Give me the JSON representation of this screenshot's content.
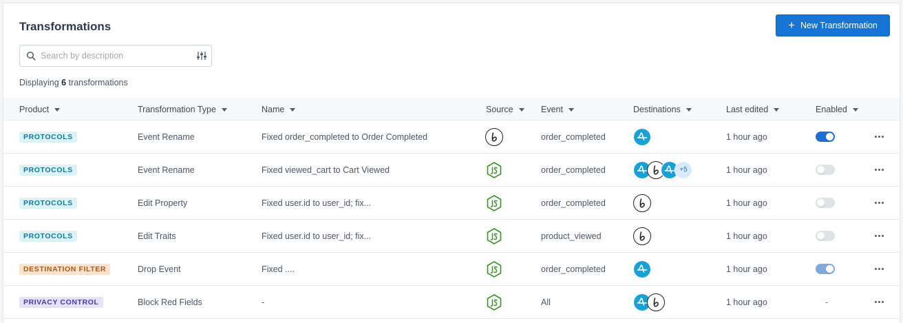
{
  "header": {
    "title": "Transformations",
    "new_button_label": "New Transformation"
  },
  "search": {
    "placeholder": "Search by description",
    "value": ""
  },
  "summary": {
    "prefix": "Displaying",
    "count": "6",
    "suffix": "transformations"
  },
  "columns": {
    "product": "Product",
    "type": "Transformation Type",
    "name": "Name",
    "source": "Source",
    "event": "Event",
    "destinations": "Destinations",
    "last_edited": "Last edited",
    "enabled": "Enabled"
  },
  "rows": [
    {
      "product": "PROTOCOLS",
      "type": "Event Rename",
      "name": "Fixed order_completed to Order Completed",
      "source_icon": "braze-icon",
      "event": "order_completed",
      "destinations": [
        "amplitude-icon"
      ],
      "extra_count": "",
      "last_edited": "1 hour ago",
      "enabled": "on"
    },
    {
      "product": "PROTOCOLS",
      "type": "Event Rename",
      "name": "Fixed viewed_cart to Cart Viewed",
      "source_icon": "javascript-icon",
      "event": "order_completed",
      "destinations": [
        "amplitude-icon",
        "braze-icon",
        "amplitude-icon"
      ],
      "extra_count": "+5",
      "last_edited": "1 hour ago",
      "enabled": "off"
    },
    {
      "product": "PROTOCOLS",
      "type": "Edit Property",
      "name": "Fixed user.id to user_id; fix...",
      "source_icon": "javascript-icon",
      "event": "order_completed",
      "destinations": [
        "braze-icon"
      ],
      "extra_count": "",
      "last_edited": "1 hour ago",
      "enabled": "off"
    },
    {
      "product": "PROTOCOLS",
      "type": "Edit Traits",
      "name": "Fixed user.id to user_id; fix...",
      "source_icon": "javascript-icon",
      "event": "product_viewed",
      "destinations": [
        "braze-icon"
      ],
      "extra_count": "",
      "last_edited": "1 hour ago",
      "enabled": "off"
    },
    {
      "product": "DESTINATION FILTER",
      "type": "Drop Event",
      "name": "Fixed ....",
      "source_icon": "javascript-icon",
      "event": "order_completed",
      "destinations": [
        "amplitude-icon"
      ],
      "extra_count": "",
      "last_edited": "1 hour ago",
      "enabled": "on-disabled"
    },
    {
      "product": "PRIVACY CONTROL",
      "type": "Block Red Fields",
      "name": "-",
      "source_icon": "javascript-icon",
      "event": "All",
      "destinations": [
        "amplitude-icon",
        "braze-icon"
      ],
      "extra_count": "",
      "last_edited": "1 hour ago",
      "enabled": "-"
    }
  ],
  "colors": {
    "accent": "#1574d4",
    "protocols": "#13789a",
    "destination_filter": "#b25610",
    "privacy_control": "#4b33b3"
  }
}
